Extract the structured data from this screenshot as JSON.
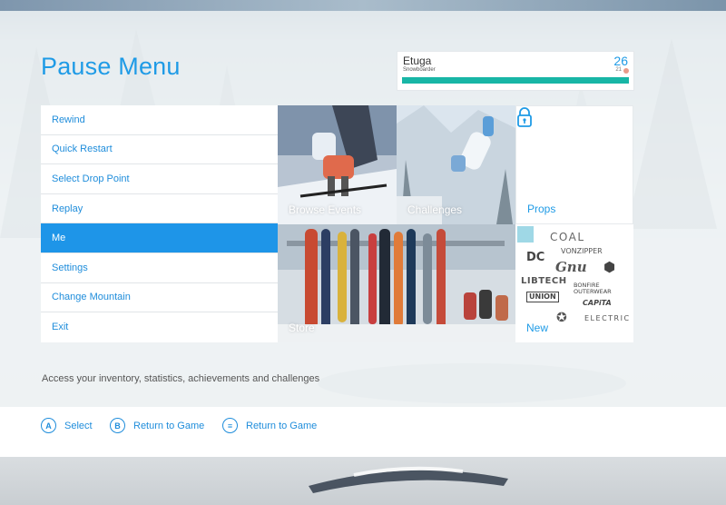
{
  "title": "Pause Menu",
  "player": {
    "name": "Etuga",
    "class": "Snowboarder",
    "level": "26",
    "next_level": "21",
    "xp_progress": 0.998
  },
  "menu": {
    "items": [
      {
        "label": "Rewind"
      },
      {
        "label": "Quick Restart"
      },
      {
        "label": "Select Drop Point"
      },
      {
        "label": "Replay"
      },
      {
        "label": "Me",
        "active": true
      },
      {
        "label": "Settings"
      },
      {
        "label": "Change Mountain"
      },
      {
        "label": "Exit"
      }
    ]
  },
  "tiles": {
    "browse_events": "Browse Events",
    "challenges": "Challenges",
    "props": "Props",
    "store": "Store",
    "new": "New"
  },
  "brands": {
    "coal": "COAL",
    "dc": "DC",
    "vonzipper": "VONZIPPER",
    "gnu": "Gnu",
    "libtech": "LIBTECH",
    "bonfire": "BONFIRE",
    "outerwear": "OUTERWEAR",
    "union": "UNION",
    "capita": "CAPiTA",
    "electric": "ELECTRIC"
  },
  "description": "Access your inventory, statistics, achievements and challenges",
  "footer": {
    "a_glyph": "A",
    "a_label": "Select",
    "b_glyph": "B",
    "b_label": "Return to Game",
    "menu_glyph": "≡",
    "menu_label": "Return to Game"
  },
  "colors": {
    "accent": "#1f9be6",
    "active_bg": "#1e95e8",
    "xp_bar": "#18b6a6"
  }
}
